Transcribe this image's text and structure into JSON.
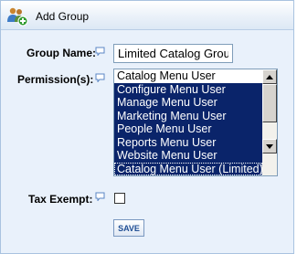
{
  "header": {
    "title": "Add Group",
    "icon": "add-group-icon"
  },
  "form": {
    "group_name_label": "Group Name:",
    "group_name_value": "Limited Catalog Group",
    "permissions_label": "Permission(s):",
    "permissions": [
      {
        "label": "Catalog Menu User",
        "selected": false
      },
      {
        "label": "Configure Menu User",
        "selected": true
      },
      {
        "label": "Manage Menu User",
        "selected": true
      },
      {
        "label": "Marketing Menu User",
        "selected": true
      },
      {
        "label": "People Menu User",
        "selected": true
      },
      {
        "label": "Reports Menu User",
        "selected": true
      },
      {
        "label": "Website Menu User",
        "selected": true
      },
      {
        "label": "Catalog Menu User (Limited)",
        "selected": true,
        "focused": true
      }
    ],
    "tax_exempt_label": "Tax Exempt:",
    "tax_exempt_checked": false,
    "save_label": "SAVE"
  },
  "colors": {
    "panel_bg": "#e9f1fb",
    "selection": "#0a246a",
    "save_text": "#1f4e94"
  },
  "icons": {
    "help": "help-speech-bubble-icon"
  }
}
